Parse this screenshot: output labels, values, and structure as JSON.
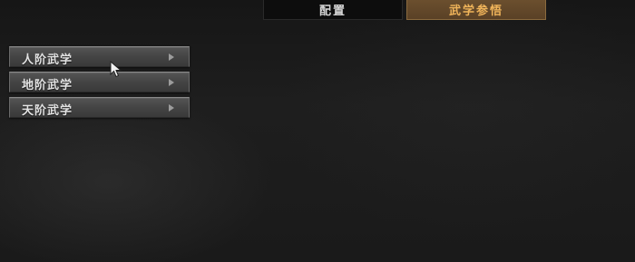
{
  "tabs": [
    {
      "label": "配置"
    },
    {
      "label": "武学参悟"
    }
  ],
  "menu": {
    "items": [
      {
        "label": "人阶武学"
      },
      {
        "label": "地阶武学"
      },
      {
        "label": "天阶武学"
      }
    ]
  },
  "colors": {
    "active_tab_text": "#f0b45a",
    "active_tab_bg": "#5a4126",
    "inactive_tab_bg": "#0d0d0d"
  },
  "icons": {
    "menu_arrow": "arrow-right-icon",
    "pointer": "mouse-cursor-icon"
  }
}
